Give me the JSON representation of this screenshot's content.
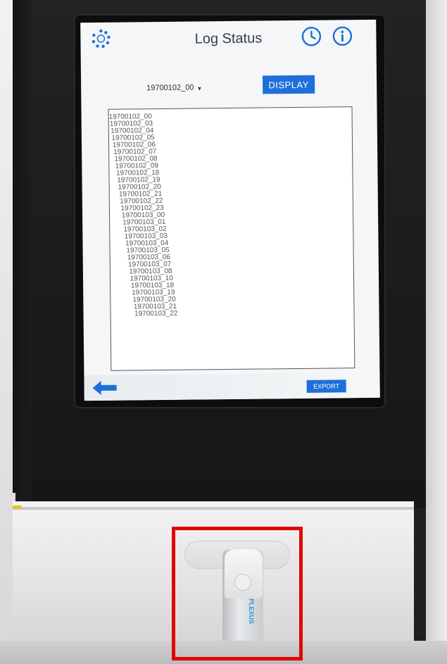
{
  "header": {
    "title": "Log Status"
  },
  "controls": {
    "selected_log": "19700102_00",
    "display_label": "DISPLAY",
    "export_label": "EXPORT"
  },
  "log_files": [
    "19700102_00",
    "19700102_03",
    "19700102_04",
    "19700102_05",
    "19700102_06",
    "19700102_07",
    "19700102_08",
    "19700102_09",
    "19700102_18",
    "19700102_19",
    "19700102_20",
    "19700102_21",
    "19700102_22",
    "19700102_23",
    "19700103_00",
    "19700103_01",
    "19700103_02",
    "19700103_03",
    "19700103_04",
    "19700103_05",
    "19700103_06",
    "19700103_07",
    "19700103_08",
    "19700103_10",
    "19700103_18",
    "19700103_19",
    "19700103_20",
    "19700103_21",
    "19700103_22"
  ],
  "icons": {
    "app": "app-logo-icon",
    "history": "clock-icon",
    "info": "info-icon",
    "back": "back-arrow-icon",
    "dropdown": "chevron-down-icon"
  },
  "colors": {
    "accent": "#1e6fd9",
    "highlight": "#e10600",
    "usb_brand": "#2a9ad8"
  },
  "usb_drive": {
    "label": "PLEXUS"
  }
}
